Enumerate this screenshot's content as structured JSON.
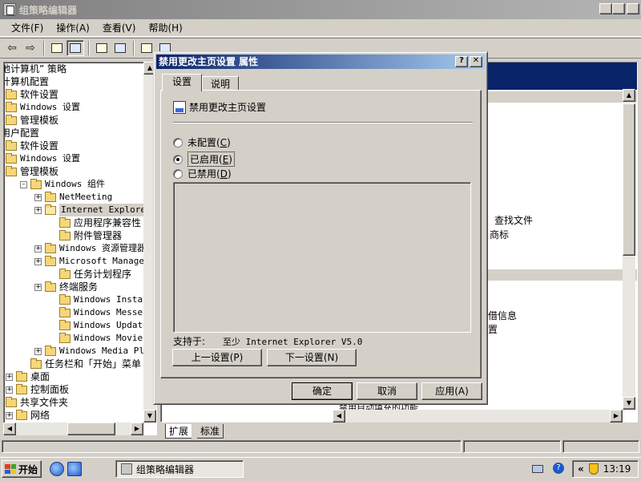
{
  "window": {
    "title": "组策略编辑器"
  },
  "menu": [
    "文件(F)",
    "操作(A)",
    "查看(V)",
    "帮助(H)"
  ],
  "toolbar_icons": [
    "back-arrow-icon",
    "forward-arrow-icon",
    "up-folder-icon",
    "show-hide-tree-icon",
    "properties-icon",
    "export-list-icon",
    "help-icon",
    "extended-view-icon"
  ],
  "tree": [
    {
      "label": "地计算机” 策略",
      "indent": 0,
      "type": "text"
    },
    {
      "label": "计算机配置",
      "indent": 0,
      "type": "text"
    },
    {
      "label": "软件设置",
      "indent": 0,
      "type": "folder"
    },
    {
      "label": "Windows 设置",
      "indent": 0,
      "type": "folder",
      "mono": true
    },
    {
      "label": "管理模板",
      "indent": 0,
      "type": "folder"
    },
    {
      "label": "用户配置",
      "indent": 0,
      "type": "text"
    },
    {
      "label": "软件设置",
      "indent": 0,
      "type": "folder"
    },
    {
      "label": "Windows 设置",
      "indent": 0,
      "type": "folder",
      "mono": true
    },
    {
      "label": "管理模板",
      "indent": 0,
      "type": "folder"
    },
    {
      "label": "Windows 组件",
      "indent": 1,
      "type": "folder",
      "expander": "-",
      "mono": true
    },
    {
      "label": "NetMeeting",
      "indent": 2,
      "type": "folder",
      "expander": "+",
      "mono": true
    },
    {
      "label": "Internet Explorer",
      "indent": 2,
      "type": "folder-open",
      "expander": "+",
      "mono": true,
      "selected": true
    },
    {
      "label": "应用程序兼容性",
      "indent": 3,
      "type": "folder"
    },
    {
      "label": "附件管理器",
      "indent": 3,
      "type": "folder"
    },
    {
      "label": "Windows 资源管理器",
      "indent": 2,
      "type": "folder",
      "expander": "+",
      "mono": true
    },
    {
      "label": "Microsoft Management",
      "indent": 2,
      "type": "folder",
      "expander": "+",
      "mono": true
    },
    {
      "label": "任务计划程序",
      "indent": 3,
      "type": "folder"
    },
    {
      "label": "终端服务",
      "indent": 2,
      "type": "folder",
      "expander": "+"
    },
    {
      "label": "Windows Installer",
      "indent": 3,
      "type": "folder",
      "mono": true
    },
    {
      "label": "Windows Messenger",
      "indent": 3,
      "type": "folder",
      "mono": true
    },
    {
      "label": "Windows Update",
      "indent": 3,
      "type": "folder",
      "mono": true
    },
    {
      "label": "Windows Movie Maker",
      "indent": 3,
      "type": "folder",
      "mono": true
    },
    {
      "label": "Windows Media Player",
      "indent": 2,
      "type": "folder",
      "expander": "+",
      "mono": true
    },
    {
      "label": "任务栏和「开始」菜单",
      "indent": 1,
      "type": "folder"
    },
    {
      "label": "桌面",
      "indent": 0,
      "type": "folder",
      "expander": "+"
    },
    {
      "label": "控制面板",
      "indent": 0,
      "type": "folder",
      "expander": "+"
    },
    {
      "label": "共享文件夹",
      "indent": 0,
      "type": "folder"
    },
    {
      "label": "网络",
      "indent": 0,
      "type": "folder",
      "expander": "+"
    }
  ],
  "right_pane": {
    "texts": [
      "查找文件",
      "商标",
      "借信息",
      "置",
      "禁用自动填充的功能"
    ],
    "tabs": [
      "扩展",
      "标准"
    ]
  },
  "dialog": {
    "title": "禁用更改主页设置 属性",
    "tabs": [
      "设置",
      "说明"
    ],
    "policy_name": "禁用更改主页设置",
    "options": [
      {
        "label": "未配置",
        "key": "C",
        "checked": false
      },
      {
        "label": "已启用",
        "key": "E",
        "checked": true
      },
      {
        "label": "已禁用",
        "key": "D",
        "checked": false
      }
    ],
    "supported_label": "支持于:",
    "supported_value": "至少 Internet Explorer V5.0",
    "prev_button": "上一设置(P)",
    "next_button": "下一设置(N)",
    "ok_button": "确定",
    "cancel_button": "取消",
    "apply_button": "应用(A)"
  },
  "taskbar": {
    "start_label": "开始",
    "task_title": "组策略编辑器",
    "clock": "13:19",
    "tray_chevron": "«"
  }
}
